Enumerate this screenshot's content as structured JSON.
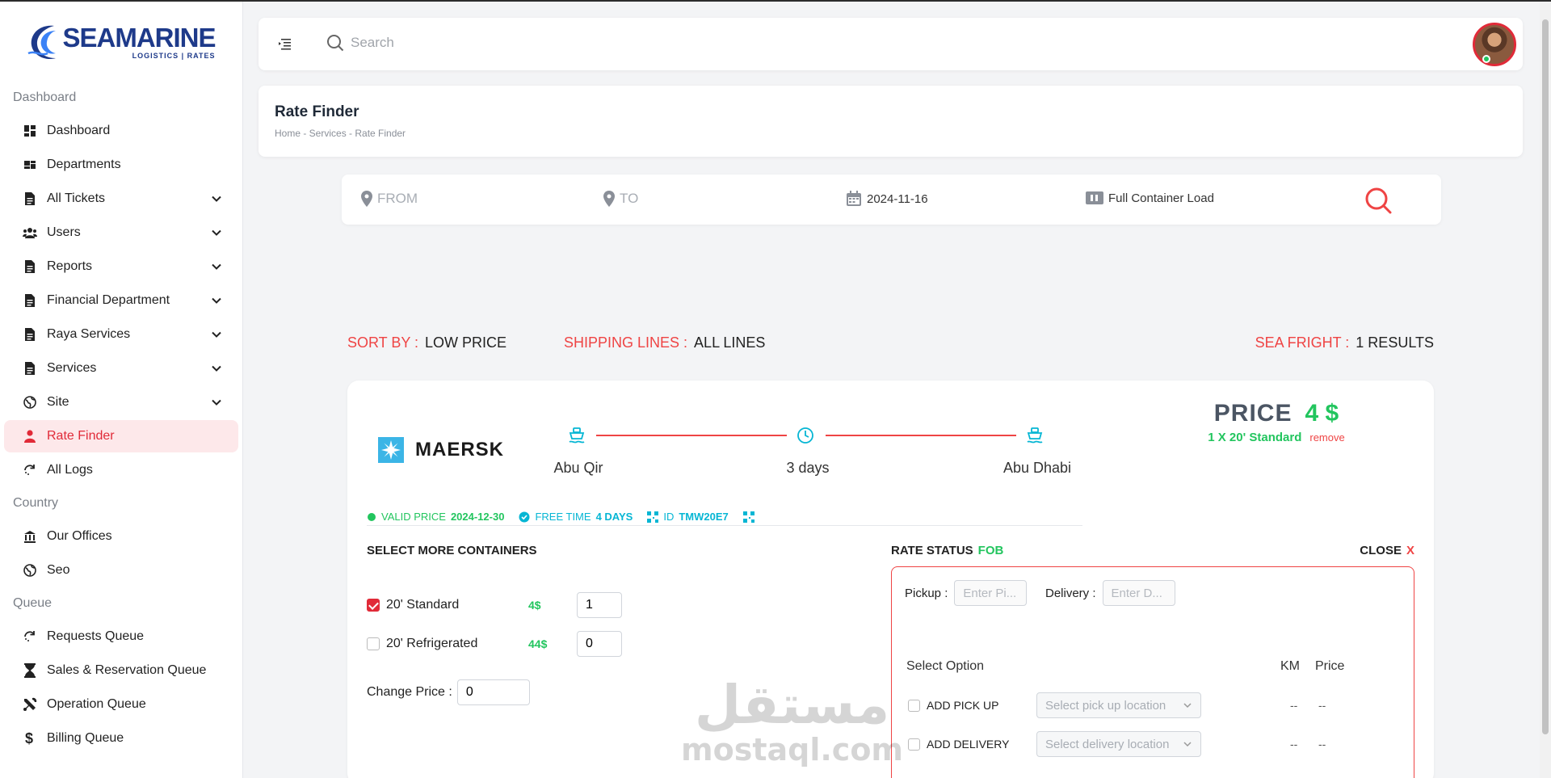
{
  "brand": {
    "name": "SEAMARINE",
    "tagline": "LOGISTICS | RATES",
    "accent": "#e12a38",
    "primary": "#1e3a8a"
  },
  "sidebar": {
    "sections": [
      {
        "title": "Dashboard",
        "items": [
          {
            "label": "Dashboard",
            "icon": "dashboard-icon",
            "chevron": false
          },
          {
            "label": "Departments",
            "icon": "departments-icon",
            "chevron": false
          },
          {
            "label": "All Tickets",
            "icon": "file-icon",
            "chevron": true
          },
          {
            "label": "Users",
            "icon": "users-icon",
            "chevron": true
          },
          {
            "label": "Reports",
            "icon": "file-icon",
            "chevron": true
          },
          {
            "label": "Financial Department",
            "icon": "file-icon",
            "chevron": true
          },
          {
            "label": "Raya Services",
            "icon": "file-icon",
            "chevron": true
          },
          {
            "label": "Services",
            "icon": "file-icon",
            "chevron": true
          },
          {
            "label": "Site",
            "icon": "globe-icon",
            "chevron": true
          },
          {
            "label": "Rate Finder",
            "icon": "user-icon",
            "chevron": false,
            "active": true
          },
          {
            "label": "All Logs",
            "icon": "refresh-icon",
            "chevron": false
          }
        ]
      },
      {
        "title": "Country",
        "items": [
          {
            "label": "Our Offices",
            "icon": "building-icon",
            "chevron": false
          },
          {
            "label": "Seo",
            "icon": "globe-icon",
            "chevron": false
          }
        ]
      },
      {
        "title": "Queue",
        "items": [
          {
            "label": "Requests Queue",
            "icon": "refresh-icon",
            "chevron": false
          },
          {
            "label": "Sales & Reservation Queue",
            "icon": "hourglass-icon",
            "chevron": false
          },
          {
            "label": "Operation Queue",
            "icon": "tools-icon",
            "chevron": false
          },
          {
            "label": "Billing Queue",
            "icon": "dollar-icon",
            "chevron": false
          }
        ]
      }
    ]
  },
  "header": {
    "search_placeholder": "Search"
  },
  "page": {
    "title": "Rate Finder",
    "breadcrumb": "Home - Services - Rate Finder"
  },
  "search_bar": {
    "from_placeholder": "FROM",
    "to_placeholder": "TO",
    "date": "2024-11-16",
    "load_type": "Full Container Load"
  },
  "filters": {
    "sort_label": "SORT BY :",
    "sort_value": "LOW PRICE",
    "lines_label": "SHIPPING LINES :",
    "lines_value": "ALL LINES",
    "results_label": "SEA FRIGHT :",
    "results_value": "1 RESULTS"
  },
  "result": {
    "carrier": "MAERSK",
    "origin": "Abu Qir",
    "duration": "3 days",
    "destination": "Abu Dhabi",
    "price_label": "PRICE",
    "price_value": "4 $",
    "container_summary": "1 X 20' Standard",
    "remove_label": "remove",
    "valid_label": "VALID PRICE",
    "valid_value": "2024-12-30",
    "free_label": "FREE TIME",
    "free_value": "4 DAYS",
    "id_label": "ID",
    "id_value": "TMW20E7",
    "containers_title": "SELECT MORE CONTAINERS",
    "containers": [
      {
        "name": "20' Standard",
        "price": "4$",
        "qty": "1",
        "checked": true
      },
      {
        "name": "20' Refrigerated",
        "price": "44$",
        "qty": "0",
        "checked": false
      }
    ],
    "change_price_label": "Change Price :",
    "change_price_value": "0",
    "rate_status_label": "RATE STATUS",
    "rate_status_value": "FOB",
    "close_label": "CLOSE",
    "close_x": "X",
    "pickup_label": "Pickup :",
    "pickup_placeholder": "Enter Pi...",
    "delivery_label": "Delivery :",
    "delivery_placeholder": "Enter D...",
    "select_option_label": "Select Option",
    "km_label": "KM",
    "price_col_label": "Price",
    "options": [
      {
        "name": "ADD PICK UP",
        "select": "Select pick up location",
        "km": "--",
        "price": "--"
      },
      {
        "name": "ADD DELIVERY",
        "select": "Select delivery location",
        "km": "--",
        "price": "--"
      }
    ]
  },
  "watermark": {
    "arabic": "مستقل",
    "latin": "mostaql.com"
  }
}
